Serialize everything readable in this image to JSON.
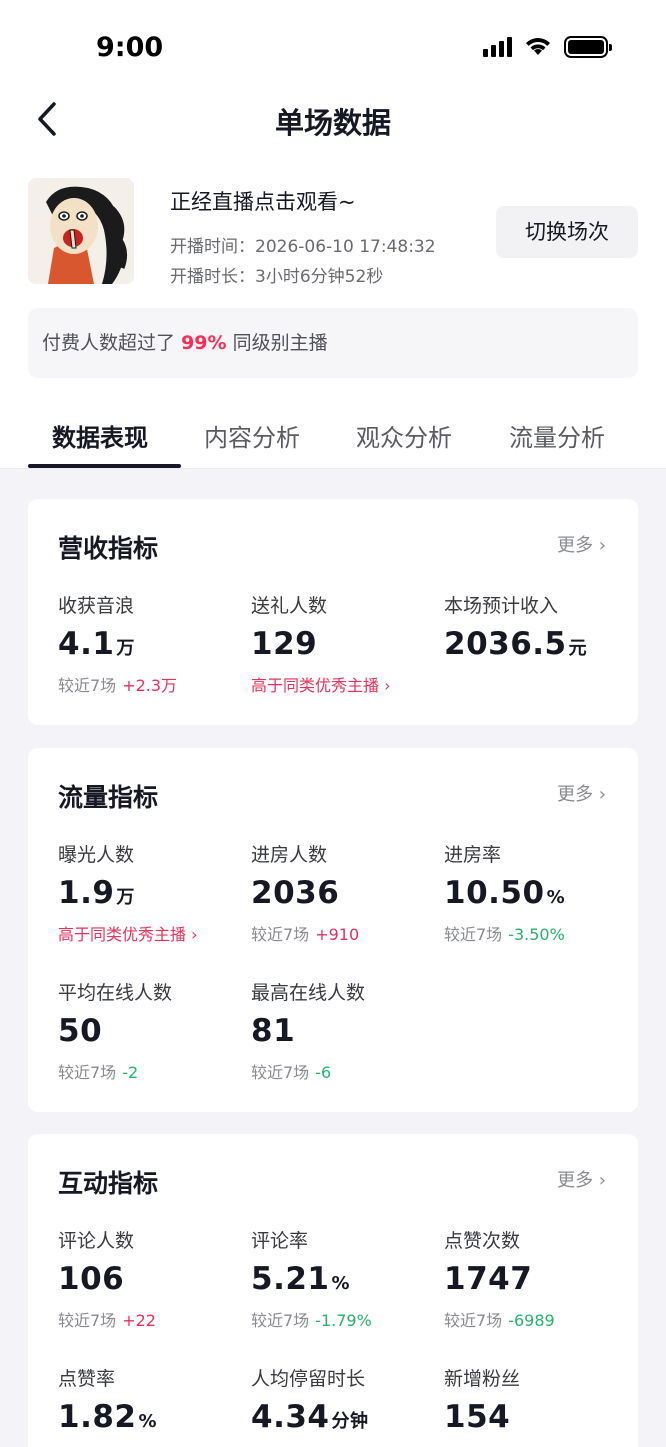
{
  "status_bar": {
    "time": "9:00"
  },
  "nav": {
    "title": "单场数据"
  },
  "live": {
    "title": "正经直播点击观看~",
    "start_time": "开播时间：2026-06-10 17:48:32",
    "duration": "开播时长：3小时6分钟52秒",
    "switch_button": "切换场次"
  },
  "banner": {
    "prefix": "付费人数超过了",
    "percent": "99%",
    "suffix": "同级别主播"
  },
  "tabs": [
    {
      "label": "数据表现",
      "active": true
    },
    {
      "label": "内容分析",
      "active": false
    },
    {
      "label": "观众分析",
      "active": false
    },
    {
      "label": "流量分析",
      "active": false
    }
  ],
  "colors": {
    "accent_red": "#fe2c55",
    "up_red": "#e6325a",
    "down_green": "#26b36b"
  },
  "cards": {
    "revenue": {
      "title": "营收指标",
      "more": "更多",
      "metrics": [
        {
          "label": "收获音浪",
          "value": "4.1",
          "unit": "万",
          "sub_prefix": "较近7场",
          "sub_change": "+2.3万"
        },
        {
          "label": "送礼人数",
          "value": "129",
          "sub_link": "高于同类优秀主播"
        },
        {
          "label": "本场预计收入",
          "value": "2036.5",
          "unit": "元"
        }
      ]
    },
    "traffic": {
      "title": "流量指标",
      "more": "更多",
      "metrics": [
        {
          "label": "曝光人数",
          "value": "1.9",
          "unit": "万",
          "sub_link": "高于同类优秀主播"
        },
        {
          "label": "进房人数",
          "value": "2036",
          "sub_prefix": "较近7场",
          "sub_change": "+910"
        },
        {
          "label": "进房率",
          "value": "10.50",
          "unit": "%",
          "sub_prefix": "较近7场",
          "sub_change": "-3.50%"
        },
        {
          "label": "平均在线人数",
          "value": "50",
          "sub_prefix": "较近7场",
          "sub_change": "-2"
        },
        {
          "label": "最高在线人数",
          "value": "81",
          "sub_prefix": "较近7场",
          "sub_change": "-6"
        }
      ]
    },
    "interaction": {
      "title": "互动指标",
      "more": "更多",
      "metrics": [
        {
          "label": "评论人数",
          "value": "106",
          "sub_prefix": "较近7场",
          "sub_change": "+22"
        },
        {
          "label": "评论率",
          "value": "5.21",
          "unit": "%",
          "sub_prefix": "较近7场",
          "sub_change": "-1.79%"
        },
        {
          "label": "点赞次数",
          "value": "1747",
          "sub_prefix": "较近7场",
          "sub_change": "-6989"
        },
        {
          "label": "点赞率",
          "value": "1.82",
          "unit": "%"
        },
        {
          "label": "人均停留时长",
          "value": "4.34",
          "unit": "分钟"
        },
        {
          "label": "新增粉丝",
          "value": "154"
        }
      ]
    }
  }
}
